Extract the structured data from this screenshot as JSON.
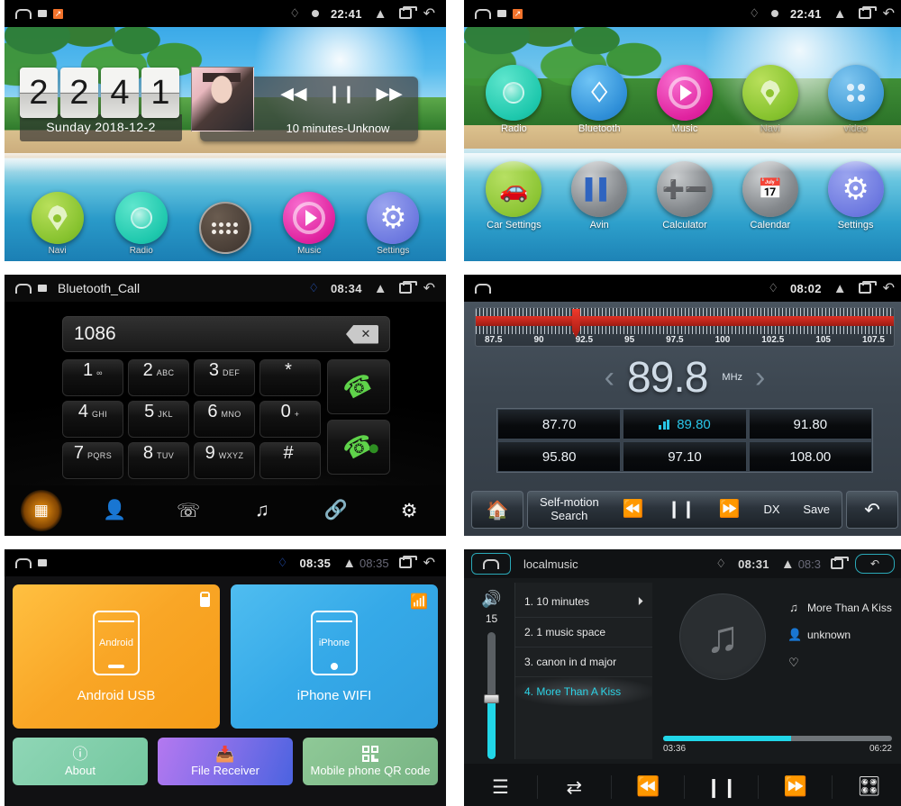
{
  "panels": {
    "home": {
      "status": {
        "time": "22:41",
        "bluetooth_icon": "bluetooth-icon",
        "home_icon": "home-icon",
        "recents_icon": "recents-icon",
        "back_icon": "back-icon",
        "expand_icon": "expand-up-icon"
      },
      "clock": {
        "d1": "2",
        "d2": "2",
        "d3": "4",
        "d4": "1",
        "date": "Sunday  2018-12-2"
      },
      "music_widget": {
        "title": "10 minutes-Unknow",
        "prev_icon": "rewind-icon",
        "pause_icon": "pause-icon",
        "next_icon": "fast-forward-icon"
      },
      "dock": [
        {
          "label": "Navi",
          "icon": "map-pin-icon"
        },
        {
          "label": "Radio",
          "icon": "radio-knob-icon"
        },
        {
          "label": "",
          "icon": "app-drawer-icon"
        },
        {
          "label": "Music",
          "icon": "music-play-icon"
        },
        {
          "label": "Settings",
          "icon": "gear-icon"
        }
      ]
    },
    "apps": {
      "status": {
        "time": "22:41"
      },
      "items": [
        {
          "label": "Radio",
          "icon": "radio-knob-icon",
          "faded": false
        },
        {
          "label": "Bluetooth",
          "icon": "bluetooth-icon",
          "faded": false
        },
        {
          "label": "Music",
          "icon": "music-play-icon",
          "faded": false
        },
        {
          "label": "Navi",
          "icon": "map-pin-icon",
          "faded": true
        },
        {
          "label": "video",
          "icon": "film-reel-icon",
          "faded": true
        },
        {
          "label": "Car Settings",
          "icon": "car-icon",
          "faded": false
        },
        {
          "label": "Avin",
          "icon": "avin-icon",
          "faded": false
        },
        {
          "label": "Calculator",
          "icon": "calculator-icon",
          "faded": false
        },
        {
          "label": "Calendar",
          "icon": "calendar-icon",
          "faded": false
        },
        {
          "label": "Settings",
          "icon": "gear-icon",
          "faded": false
        }
      ]
    },
    "bluetooth": {
      "title": "Bluetooth_Call",
      "status": {
        "time": "08:34"
      },
      "number": "1086",
      "backspace_icon": "backspace-icon",
      "keys": [
        {
          "big": "1",
          "sub": "∞"
        },
        {
          "big": "2",
          "sub": "ABC"
        },
        {
          "big": "3",
          "sub": "DEF"
        },
        {
          "big": "*",
          "sub": ""
        },
        {
          "big": "4",
          "sub": "GHI"
        },
        {
          "big": "5",
          "sub": "JKL"
        },
        {
          "big": "6",
          "sub": "MNO"
        },
        {
          "big": "0",
          "sub": "+"
        },
        {
          "big": "7",
          "sub": "PQRS"
        },
        {
          "big": "8",
          "sub": "TUV"
        },
        {
          "big": "9",
          "sub": "WXYZ"
        },
        {
          "big": "#",
          "sub": ""
        }
      ],
      "call_icon": "call-icon",
      "transfer_call_icon": "call-transfer-icon",
      "tabs": [
        {
          "icon": "dialpad-icon",
          "active": true
        },
        {
          "icon": "contacts-icon",
          "active": false
        },
        {
          "icon": "call-history-icon",
          "active": false
        },
        {
          "icon": "bt-music-icon",
          "active": false
        },
        {
          "icon": "link-icon",
          "active": false
        },
        {
          "icon": "gear-icon",
          "active": false
        }
      ]
    },
    "radio": {
      "status": {
        "time": "08:02"
      },
      "frequency": "89.8",
      "unit": "MHz",
      "scale_labels": [
        "87.5",
        "90",
        "92.5",
        "95",
        "97.5",
        "100",
        "102.5",
        "105",
        "107.5"
      ],
      "cursor_percent": 23,
      "presets": [
        {
          "value": "87.70",
          "active": false
        },
        {
          "value": "89.80",
          "active": true
        },
        {
          "value": "91.80",
          "active": false
        },
        {
          "value": "95.80",
          "active": false
        },
        {
          "value": "97.10",
          "active": false
        },
        {
          "value": "108.00",
          "active": false
        }
      ],
      "toolbar": {
        "home_icon": "home-icon",
        "search_label": "Self-motion\nSearch",
        "prev_icon": "prev-track-icon",
        "pause_icon": "pause-icon",
        "next_icon": "next-track-icon",
        "dx_label": "DX",
        "save_label": "Save",
        "back_icon": "back-icon"
      },
      "colors": {
        "accent": "#29c6e8",
        "band": "#e03024"
      }
    },
    "link": {
      "status": {
        "time": "08:35",
        "ghost_time": "08:35"
      },
      "cards": [
        {
          "label": "Android USB",
          "device": "Android",
          "corner_icon": "usb-icon",
          "color": "#f9a626"
        },
        {
          "label": "iPhone WIFI",
          "device": "iPhone",
          "corner_icon": "wifi-icon",
          "color": "#35a9e8"
        }
      ],
      "pills": [
        {
          "label": "About",
          "icon": "info-icon"
        },
        {
          "label": "File Receiver",
          "icon": "inbox-download-icon"
        },
        {
          "label": "Mobile phone QR code",
          "icon": "qr-code-icon"
        }
      ]
    },
    "localmusic": {
      "title": "localmusic",
      "status": {
        "time": "08:31",
        "ghost_time": "08:3"
      },
      "volume": {
        "value": "15",
        "icon": "volume-icon"
      },
      "playlist": [
        {
          "label": "1. 10 minutes",
          "active": false,
          "trailing_icon": "play-circle-icon"
        },
        {
          "label": "2. 1 music space",
          "active": false,
          "trailing_icon": ""
        },
        {
          "label": "3. canon in d major",
          "active": false,
          "trailing_icon": ""
        },
        {
          "label": "4. More Than A Kiss",
          "active": true,
          "trailing_icon": ""
        }
      ],
      "now_playing": {
        "art_icon": "music-note-icon",
        "track": "More Than A Kiss",
        "artist": "unknown",
        "track_icon": "music-note-icon",
        "artist_icon": "person-icon",
        "favorite_icon": "heart-icon",
        "elapsed": "03:36",
        "duration": "06:22",
        "progress_percent": 56
      },
      "controls": [
        {
          "icon": "playlist-icon"
        },
        {
          "icon": "repeat-icon"
        },
        {
          "icon": "previous-icon"
        },
        {
          "icon": "pause-icon"
        },
        {
          "icon": "next-icon"
        },
        {
          "icon": "equalizer-icon"
        }
      ]
    }
  }
}
